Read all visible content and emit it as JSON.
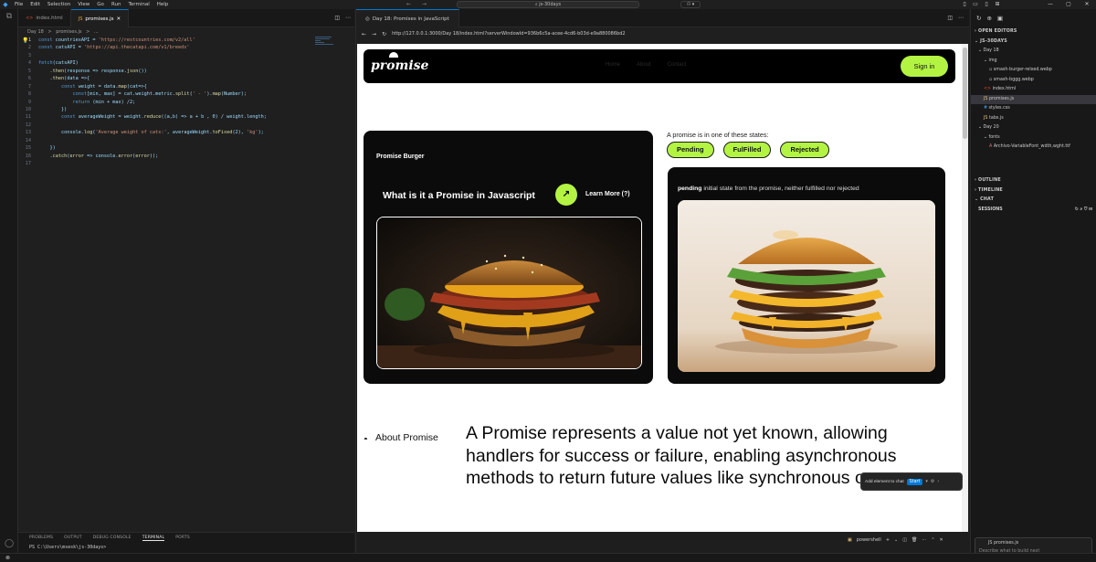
{
  "titlebar": {
    "menu": [
      "File",
      "Edit",
      "Selection",
      "View",
      "Go",
      "Run",
      "Terminal",
      "Help"
    ],
    "search": "js-30days"
  },
  "editor": {
    "tabs": [
      {
        "label": "index.html",
        "type": "html",
        "active": false
      },
      {
        "label": "promises.js",
        "type": "js",
        "active": true
      }
    ],
    "breadcrumb": [
      "Day 18",
      ">",
      "promises.js",
      ">",
      "..."
    ],
    "lines": [
      "const countriesAPI = 'https://restcountries.com/v2/all'",
      "const catsAPI = 'https://api.thecatapi.com/v1/breeds'",
      "",
      "fetch(catsAPI)",
      "    .then(response => response.json())",
      "    .then(data =>{",
      "        const weight = data.map(cat=>{",
      "            const[min, max] = cat.weight.metric.split(' - ').map(Number);",
      "            return (min + max) /2;",
      "        })",
      "        const averageWeight = weight.reduce((a,b) => a + b , 0) / weight.length;",
      "",
      "        console.log('Average weight of cats:', averageWeight.toFixed(2), 'kg');",
      "",
      "    })",
      "    .catch(error => console.error(error));",
      ""
    ]
  },
  "panel": {
    "tabs": [
      "PROBLEMS",
      "OUTPUT",
      "DEBUG CONSOLE",
      "TERMINAL",
      "PORTS"
    ],
    "active_tab": "TERMINAL",
    "prompt": "PS C:\\Users\\msesk\\js-30days>"
  },
  "browser": {
    "tab_title": "Day 18: Promises in JavaScript",
    "url": "http://127.0.0.1:3000/Day 18/index.html?serverWindowId=936b6c5a-acee-4cd6-b03d-e9a880086bd2"
  },
  "site": {
    "logo": "promise",
    "nav_links": [
      "Home",
      "About",
      "Contact"
    ],
    "signin": "Sign in",
    "card_label": "Promise Burger",
    "card_heading": "What is it a Promise in Javascript",
    "arrow": "↗",
    "learn_more": "Learn More (?)",
    "states_label": "A promise is in one of these states:",
    "states": [
      "Pending",
      "FulFilled",
      "Rejected"
    ],
    "state_term": "pending",
    "state_desc": " initial state from the promise, neither fulfilled nor rejected",
    "about_label": "About Promise",
    "about_text": "A Promise represents a value not yet known, allowing handlers for success or failure, enabling asynchronous methods to return future values like synchronous ones."
  },
  "chat_popup": {
    "label": "Add element to chat",
    "start": "Start"
  },
  "explorer": {
    "sections": {
      "open_editors": "OPEN EDITORS",
      "project": "JS-30DAYS",
      "outline": "OUTLINE",
      "timeline": "TIMELINE",
      "chat": "CHAT",
      "sessions": "SESSIONS"
    },
    "tree": [
      {
        "label": "Day 18",
        "kind": "folder",
        "indent": 1
      },
      {
        "label": "img",
        "kind": "folder",
        "indent": 2
      },
      {
        "label": "smash-burger-relxed.webp",
        "kind": "img",
        "indent": 3
      },
      {
        "label": "smash-bggg.webp",
        "kind": "img",
        "indent": 3
      },
      {
        "label": "index.html",
        "kind": "html",
        "indent": 2
      },
      {
        "label": "promises.js",
        "kind": "js",
        "indent": 2
      },
      {
        "label": "styles.css",
        "kind": "css",
        "indent": 2
      },
      {
        "label": "tabs.js",
        "kind": "js",
        "indent": 2
      },
      {
        "label": "Day 20",
        "kind": "folder",
        "indent": 1
      },
      {
        "label": "fonts",
        "kind": "folder",
        "indent": 2
      },
      {
        "label": "Archivo-VariableFont_wdth,wght.ttf",
        "kind": "font",
        "indent": 3
      }
    ],
    "chat_file": "promises.js",
    "chat_placeholder": "Describe what to build next"
  },
  "statusbar": {
    "terminal_name": "powershell"
  }
}
